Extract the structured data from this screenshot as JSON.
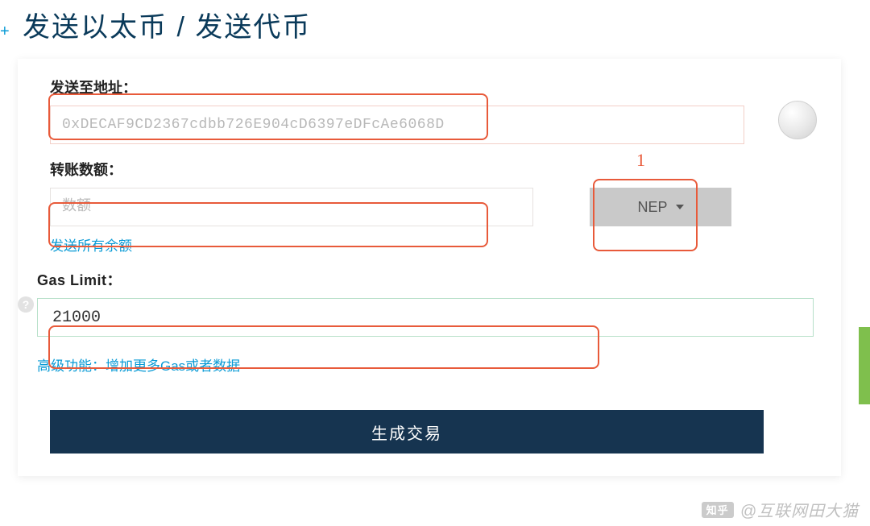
{
  "title": "发送以太币 / 发送代币",
  "address": {
    "label": "发送至地址：",
    "placeholder": "0xDECAF9CD2367cdbb726E904cD6397eDFcAe6068D",
    "value": ""
  },
  "amount": {
    "label": "转账数额：",
    "placeholder": "数额",
    "value": "",
    "send_all_link": "发送所有余额",
    "token_selected": "NEP"
  },
  "gas": {
    "label": "Gas Limit：",
    "value": "21000",
    "advanced_link": "高级功能：增加更多Gas或者数据"
  },
  "generate_button": "生成交易",
  "annotation_1": "1",
  "watermark": "@互联网田大猫",
  "watermark_brand": "知乎"
}
